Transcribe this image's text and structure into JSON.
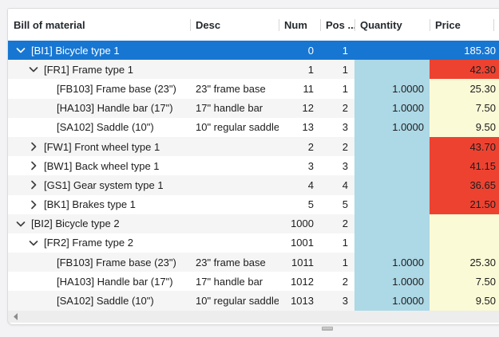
{
  "table": {
    "columns": [
      {
        "key": "bom",
        "label": "Bill of material"
      },
      {
        "key": "desc",
        "label": "Desc"
      },
      {
        "key": "num",
        "label": "Num"
      },
      {
        "key": "pos",
        "label": "Pos ..."
      },
      {
        "key": "quantity",
        "label": "Quantity"
      },
      {
        "key": "price",
        "label": "Price"
      }
    ],
    "rows": [
      {
        "name": "[BI1] Bicycle type 1",
        "level": 0,
        "expander": "expanded",
        "desc": "",
        "num": "0",
        "pos": "1",
        "quantity": "",
        "price": "185.30",
        "price_bg": "none",
        "selected": true
      },
      {
        "name": "[FR1] Frame type 1",
        "level": 1,
        "expander": "expanded",
        "desc": "",
        "num": "1",
        "pos": "1",
        "quantity": "",
        "price": "42.30",
        "price_bg": "red",
        "selected": false
      },
      {
        "name": "[FB103] Frame base (23\")",
        "level": 2,
        "expander": "leaf",
        "desc": "23\" frame base",
        "num": "11",
        "pos": "1",
        "quantity": "1.0000",
        "price": "25.30",
        "price_bg": "yellow",
        "selected": false
      },
      {
        "name": "[HA103] Handle bar (17\")",
        "level": 2,
        "expander": "leaf",
        "desc": "17\" handle bar",
        "num": "12",
        "pos": "2",
        "quantity": "1.0000",
        "price": "7.50",
        "price_bg": "yellow",
        "selected": false
      },
      {
        "name": "[SA102] Saddle (10\")",
        "level": 2,
        "expander": "leaf",
        "desc": "10\" regular saddle",
        "num": "13",
        "pos": "3",
        "quantity": "1.0000",
        "price": "9.50",
        "price_bg": "yellow",
        "selected": false
      },
      {
        "name": "[FW1] Front wheel type 1",
        "level": 1,
        "expander": "collapsed",
        "desc": "",
        "num": "2",
        "pos": "2",
        "quantity": "",
        "price": "43.70",
        "price_bg": "red",
        "selected": false
      },
      {
        "name": "[BW1] Back wheel type 1",
        "level": 1,
        "expander": "collapsed",
        "desc": "",
        "num": "3",
        "pos": "3",
        "quantity": "",
        "price": "41.15",
        "price_bg": "red",
        "selected": false
      },
      {
        "name": "[GS1] Gear system type 1",
        "level": 1,
        "expander": "collapsed",
        "desc": "",
        "num": "4",
        "pos": "4",
        "quantity": "",
        "price": "36.65",
        "price_bg": "red",
        "selected": false
      },
      {
        "name": "[BK1] Brakes type 1",
        "level": 1,
        "expander": "collapsed",
        "desc": "",
        "num": "5",
        "pos": "5",
        "quantity": "",
        "price": "21.50",
        "price_bg": "red",
        "selected": false
      },
      {
        "name": "[BI2] Bicycle type 2",
        "level": 0,
        "expander": "expanded",
        "desc": "",
        "num": "1000",
        "pos": "2",
        "quantity": "",
        "price": "",
        "price_bg": "yellow",
        "selected": false
      },
      {
        "name": "[FR2] Frame type 2",
        "level": 1,
        "expander": "expanded",
        "desc": "",
        "num": "1001",
        "pos": "1",
        "quantity": "",
        "price": "",
        "price_bg": "yellow",
        "selected": false
      },
      {
        "name": "[FB103] Frame base (23\")",
        "level": 2,
        "expander": "leaf",
        "desc": "23\" frame base",
        "num": "1011",
        "pos": "1",
        "quantity": "1.0000",
        "price": "25.30",
        "price_bg": "yellow",
        "selected": false
      },
      {
        "name": "[HA103] Handle bar (17\")",
        "level": 2,
        "expander": "leaf",
        "desc": "17\" handle bar",
        "num": "1012",
        "pos": "2",
        "quantity": "1.0000",
        "price": "7.50",
        "price_bg": "yellow",
        "selected": false
      },
      {
        "name": "[SA102] Saddle (10\")",
        "level": 2,
        "expander": "leaf",
        "desc": "10\" regular saddle",
        "num": "1013",
        "pos": "3",
        "quantity": "1.0000",
        "price": "9.50",
        "price_bg": "yellow",
        "selected": false
      }
    ]
  },
  "colors": {
    "selected_row": "#1776d2",
    "quantity_column_bg": "#add8e6",
    "price_red_bg": "#ee4231",
    "price_yellow_bg": "#fafad7",
    "stripe_row_bg": "#f5f5f5"
  },
  "icons": {
    "expanded": "chevron-down-icon",
    "collapsed": "chevron-right-icon",
    "scroll_left": "scroll-left-arrow-icon"
  }
}
